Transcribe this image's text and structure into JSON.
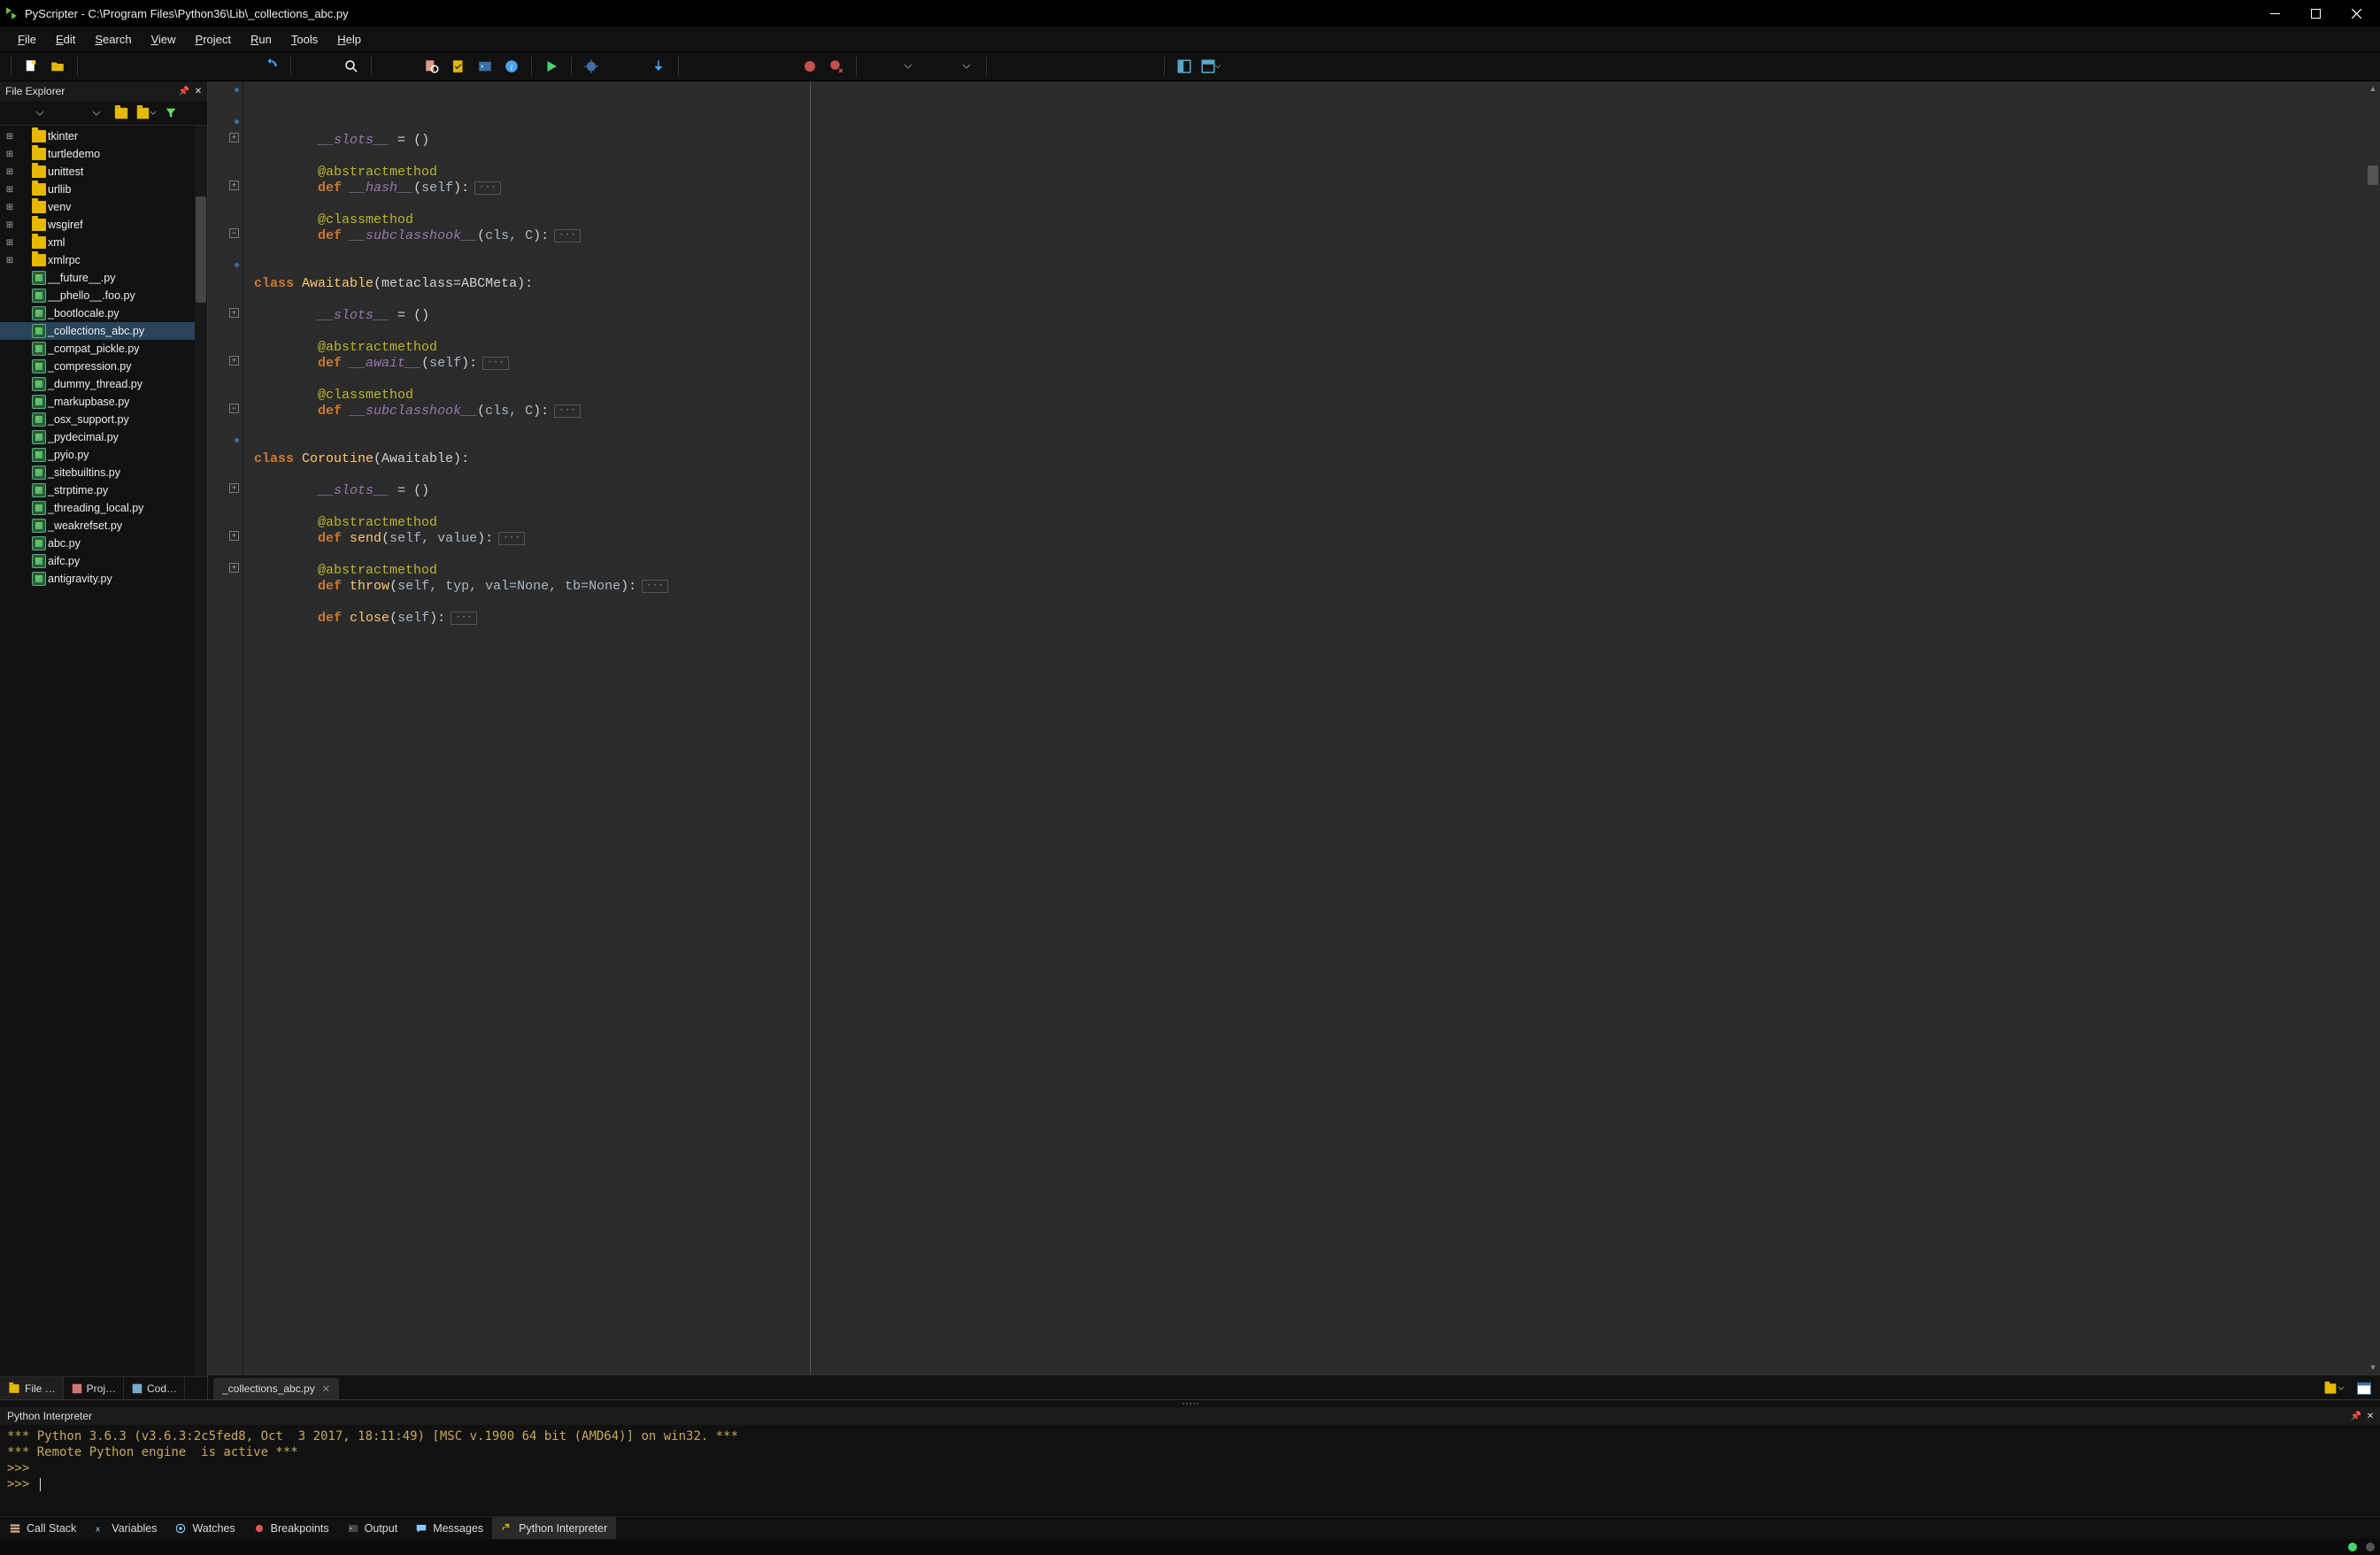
{
  "titlebar": {
    "app": "PyScripter",
    "path": "C:\\Program Files\\Python36\\Lib\\_collections_abc.py"
  },
  "menu": [
    "File",
    "Edit",
    "Search",
    "View",
    "Project",
    "Run",
    "Tools",
    "Help"
  ],
  "file_explorer": {
    "title": "File Explorer",
    "folders": [
      "tkinter",
      "turtledemo",
      "unittest",
      "urllib",
      "venv",
      "wsgiref",
      "xml",
      "xmlrpc"
    ],
    "files": [
      "__future__.py",
      "__phello__.foo.py",
      "_bootlocale.py",
      "_collections_abc.py",
      "_compat_pickle.py",
      "_compression.py",
      "_dummy_thread.py",
      "_markupbase.py",
      "_osx_support.py",
      "_pydecimal.py",
      "_pyio.py",
      "_sitebuiltins.py",
      "_strptime.py",
      "_threading_local.py",
      "_weakrefset.py",
      "abc.py",
      "aifc.py",
      "antigravity.py"
    ],
    "selected": "_collections_abc.py"
  },
  "side_tabs": [
    "File …",
    "Proj…",
    "Cod…"
  ],
  "editor": {
    "tab_name": "_collections_abc.py",
    "lines": [
      {
        "indent": 2,
        "type": "slots",
        "g": "dot"
      },
      {
        "type": "blank"
      },
      {
        "indent": 2,
        "type": "decorator",
        "text": "@abstractmethod",
        "g": "dot"
      },
      {
        "indent": 2,
        "type": "def",
        "name": "__hash__",
        "params": "self",
        "fold": true,
        "g": "plus"
      },
      {
        "type": "blank"
      },
      {
        "indent": 2,
        "type": "decorator",
        "text": "@classmethod"
      },
      {
        "indent": 2,
        "type": "def",
        "name": "__subclasshook__",
        "params": "cls, C",
        "fold": true,
        "g": "plus"
      },
      {
        "type": "blank"
      },
      {
        "type": "blank"
      },
      {
        "indent": 0,
        "type": "class",
        "name": "Awaitable",
        "tail": "(metaclass=ABCMeta):",
        "g": "minus"
      },
      {
        "type": "blank"
      },
      {
        "indent": 2,
        "type": "slots",
        "g": "dot"
      },
      {
        "type": "blank"
      },
      {
        "indent": 2,
        "type": "decorator",
        "text": "@abstractmethod"
      },
      {
        "indent": 2,
        "type": "def",
        "name": "__await__",
        "params": "self",
        "fold": true,
        "g": "plus"
      },
      {
        "type": "blank"
      },
      {
        "indent": 2,
        "type": "decorator",
        "text": "@classmethod"
      },
      {
        "indent": 2,
        "type": "def",
        "name": "__subclasshook__",
        "params": "cls, C",
        "fold": true,
        "g": "plus"
      },
      {
        "type": "blank"
      },
      {
        "type": "blank"
      },
      {
        "indent": 0,
        "type": "class",
        "name": "Coroutine",
        "tail": "(Awaitable):",
        "g": "minus"
      },
      {
        "type": "blank"
      },
      {
        "indent": 2,
        "type": "slots",
        "g": "dot"
      },
      {
        "type": "blank"
      },
      {
        "indent": 2,
        "type": "decorator",
        "text": "@abstractmethod"
      },
      {
        "indent": 2,
        "type": "def",
        "name": "send",
        "params": "self, value",
        "fold": true,
        "g": "plus"
      },
      {
        "type": "blank"
      },
      {
        "indent": 2,
        "type": "decorator",
        "text": "@abstractmethod"
      },
      {
        "indent": 2,
        "type": "def",
        "name": "throw",
        "params": "self, typ, val=None, tb=None",
        "fold": true,
        "g": "plus"
      },
      {
        "type": "blank"
      },
      {
        "indent": 2,
        "type": "def",
        "name": "close",
        "params": "self",
        "fold": true,
        "g": "plus"
      }
    ]
  },
  "interpreter": {
    "title": "Python Interpreter",
    "lines": [
      "*** Python 3.6.3 (v3.6.3:2c5fed8, Oct  3 2017, 18:11:49) [MSC v.1900 64 bit (AMD64)] on win32. ***",
      "*** Remote Python engine  is active ***",
      ">>>",
      ">>> "
    ]
  },
  "bottom_tabs": [
    "Call Stack",
    "Variables",
    "Watches",
    "Breakpoints",
    "Output",
    "Messages",
    "Python Interpreter"
  ],
  "active_bottom_tab": "Python Interpreter",
  "colors": {
    "status_green": "#42d66b"
  }
}
